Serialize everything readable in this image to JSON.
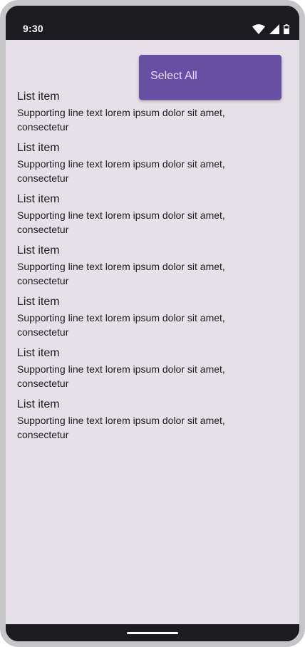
{
  "status_bar": {
    "time": "9:30",
    "icons": [
      "wifi-icon",
      "signal-icon",
      "battery-icon"
    ]
  },
  "menu": {
    "items": [
      {
        "label": "Select All"
      }
    ],
    "background": "#6750a4",
    "text_color": "#e8ddff"
  },
  "list": {
    "items": [
      {
        "headline": "List item",
        "supporting": "Supporting line text lorem ipsum dolor sit amet, consectetur"
      },
      {
        "headline": "List item",
        "supporting": "Supporting line text lorem ipsum dolor sit amet, consectetur"
      },
      {
        "headline": "List item",
        "supporting": "Supporting line text lorem ipsum dolor sit amet, consectetur"
      },
      {
        "headline": "List item",
        "supporting": "Supporting line text lorem ipsum dolor sit amet, consectetur"
      },
      {
        "headline": "List item",
        "supporting": "Supporting line text lorem ipsum dolor sit amet, consectetur"
      },
      {
        "headline": "List item",
        "supporting": "Supporting line text lorem ipsum dolor sit amet, consectetur"
      },
      {
        "headline": "List item",
        "supporting": "Supporting line text lorem ipsum dolor sit amet, consectetur"
      }
    ]
  },
  "colors": {
    "screen_background": "#e6e0e9",
    "system_bar": "#1c1b1f",
    "device_frame": "#c6c6c8"
  }
}
